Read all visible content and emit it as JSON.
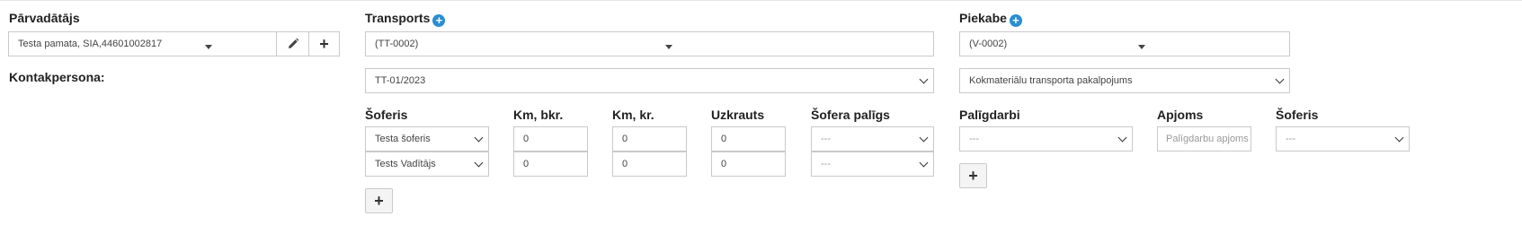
{
  "carrier": {
    "label": "Pārvadātājs",
    "value": "Testa pamata, SIA,44601002817",
    "edit_icon": "pencil-icon",
    "add_icon": "plus-icon",
    "contact_label": "Kontakpersona:"
  },
  "transport": {
    "label": "Transports",
    "value": "(TT-0002)",
    "document_value": "TT-01/2023"
  },
  "trailer": {
    "label": "Piekabe",
    "value": "(V-0002)",
    "service_value": "Kokmateriālu transporta pakalpojums"
  },
  "drivers": {
    "headers": {
      "driver": "Šoferis",
      "km_bkr": "Km, bkr.",
      "km_kr": "Km, kr.",
      "loaded": "Uzkrauts",
      "assistant": "Šofera palīgs"
    },
    "rows": [
      {
        "driver": "Testa šoferis",
        "km_bkr": "0",
        "km_kr": "0",
        "loaded": "0",
        "assistant": "---"
      },
      {
        "driver": "Tests Vadītājs",
        "km_bkr": "0",
        "km_kr": "0",
        "loaded": "0",
        "assistant": "---"
      }
    ],
    "add_label": "+"
  },
  "aux": {
    "headers": {
      "work": "Palīgdarbi",
      "amount": "Apjoms",
      "driver": "Šoferis"
    },
    "row": {
      "work": "---",
      "amount_placeholder": "Palīgdarbu apjoms",
      "driver": "---"
    },
    "add_label": "+"
  }
}
